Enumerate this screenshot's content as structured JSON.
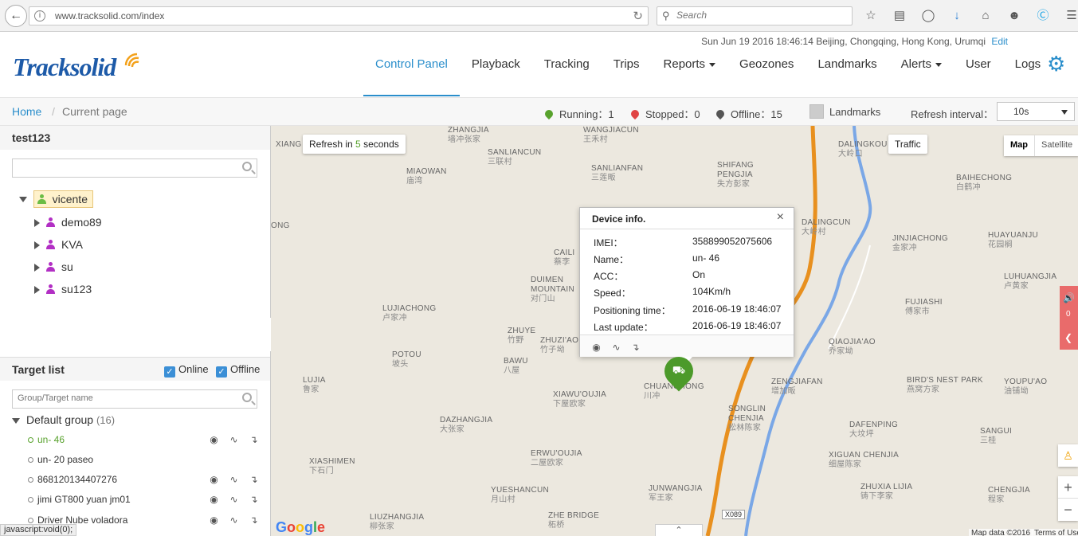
{
  "browser": {
    "url": "www.tracksolid.com/index",
    "search_placeholder": "Search"
  },
  "header": {
    "datetime": "Sun Jun 19 2016 18:46:14 Beijing, Chongqing, Hong Kong, Urumqi",
    "edit": "Edit",
    "logo_main": "Track",
    "logo_accent": "solid"
  },
  "nav": {
    "items": [
      {
        "label": "Control Panel"
      },
      {
        "label": "Playback"
      },
      {
        "label": "Tracking"
      },
      {
        "label": "Trips"
      },
      {
        "label": "Reports"
      },
      {
        "label": "Geozones"
      },
      {
        "label": "Landmarks"
      },
      {
        "label": "Alerts"
      },
      {
        "label": "User"
      },
      {
        "label": "Logs"
      }
    ]
  },
  "statusbar": {
    "home": "Home",
    "separator": "/",
    "current": "Current page",
    "running": "Running：1",
    "stopped": "Stopped：0",
    "offline": "Offline：15",
    "landmarks": "Landmarks",
    "refresh_label": "Refresh interval：",
    "refresh_value": "10s",
    "colors": {
      "running": "#58a22d",
      "stopped": "#e04343",
      "offline": "#555555"
    }
  },
  "accounts": {
    "title": "test123",
    "root": "vicente",
    "children": [
      "demo89",
      "KVA",
      "su",
      "su123"
    ],
    "colors": {
      "root_icon": "#6bbd45",
      "child_icon": "#b22fc4"
    }
  },
  "targets": {
    "title": "Target list",
    "online_label": "Online",
    "offline_label": "Offline",
    "search_placeholder": "Group/Target name",
    "group_name": "Default group",
    "group_count": "(16)",
    "items": [
      {
        "name": "un- 46"
      },
      {
        "name": "un- 20 paseo"
      },
      {
        "name": "868120134407276"
      },
      {
        "name": "jimi GT800 yuan jm01"
      },
      {
        "name": "Driver Nube voladora"
      }
    ]
  },
  "map": {
    "refresh_prefix": "Refresh in",
    "refresh_count": "5",
    "refresh_suffix": "seconds",
    "traffic": "Traffic",
    "map_btn": "Map",
    "satellite_btn": "Satellite",
    "road": "X089",
    "map_data": "Map data ©2016",
    "terms": "Terms of Use",
    "side_count": "0",
    "places": [
      {
        "en": "ZHANGJIA",
        "cn": "墙冲张家"
      },
      {
        "en": "WANGJIACUN",
        "cn": "王禾村"
      },
      {
        "en": "SANLIANCUN",
        "cn": "三联村"
      },
      {
        "en": "SANLIANFAN",
        "cn": "三莲畈"
      },
      {
        "en": "SHIFANG PENGJIA",
        "cn": "失方彭家"
      },
      {
        "en": "DALINGKOU",
        "cn": "大岭口"
      },
      {
        "en": "BAIHECHONG",
        "cn": "白鹤冲"
      },
      {
        "en": "MIAOWAN",
        "cn": "庙湾"
      },
      {
        "en": "DALINGCUN",
        "cn": "大岭村"
      },
      {
        "en": "JINJIACHONG",
        "cn": "金家冲"
      },
      {
        "en": "HUAYUANJU",
        "cn": "花园榈"
      },
      {
        "en": "CAILI",
        "cn": "蔡李"
      },
      {
        "en": "DUIMEN MOUNTAIN",
        "cn": "对门山"
      },
      {
        "en": "LUJIACHONG",
        "cn": "卢家冲"
      },
      {
        "en": "LUHUANGJIA",
        "cn": "卢黄家"
      },
      {
        "en": "FUJIASHI",
        "cn": "傅家市"
      },
      {
        "en": "ZHUYE",
        "cn": "竹野"
      },
      {
        "en": "ZHUZI'AO",
        "cn": "竹子坳"
      },
      {
        "en": "QIAOJIA'AO",
        "cn": "乔家坳"
      },
      {
        "en": "POTOU",
        "cn": "坡头"
      },
      {
        "en": "BAWU",
        "cn": "八屋"
      },
      {
        "en": "LUJIA",
        "cn": "鲁家"
      },
      {
        "en": "XIAWU'OUJIA",
        "cn": "下屋欧家"
      },
      {
        "en": "CHUANCHONG",
        "cn": "川冲"
      },
      {
        "en": "ZENGJIAFAN",
        "cn": "增加畈"
      },
      {
        "en": "BIRD'S NEST PARK",
        "cn": "燕窝方家"
      },
      {
        "en": "YOUPU'AO",
        "cn": "油铺坳"
      },
      {
        "en": "DAZHANGJIA",
        "cn": "大张家"
      },
      {
        "en": "SONGLIN CHENJIA",
        "cn": "松林陈家"
      },
      {
        "en": "DAFENPING",
        "cn": "大坟坪"
      },
      {
        "en": "SANGUI",
        "cn": "三桂"
      },
      {
        "en": "ERWU'OUJIA",
        "cn": "二屋欧家"
      },
      {
        "en": "XIGUAN CHENJIA",
        "cn": "细屋陈家"
      },
      {
        "en": "XIASHIMEN",
        "cn": "下石门"
      },
      {
        "en": "YUESHANCUN",
        "cn": "月山村"
      },
      {
        "en": "JUNWANGJIA",
        "cn": "军王家"
      },
      {
        "en": "ZHUXIA LIJIA",
        "cn": "铸下李家"
      },
      {
        "en": "CHENGJIA",
        "cn": "程家"
      },
      {
        "en": "LIUZHANGJIA",
        "cn": "柳张家"
      },
      {
        "en": "ZHE BRIDGE",
        "cn": "柘桥"
      },
      {
        "en": "XIANG",
        "cn": ""
      },
      {
        "en": "ONG",
        "cn": ""
      }
    ],
    "colors": {
      "marker": "#4c9a2a",
      "river": "#7aa7e6",
      "highway": "#e8901f"
    }
  },
  "popup": {
    "title": "Device info.",
    "close": "×",
    "rows": [
      {
        "label": "IMEI：",
        "value": "358899052075606"
      },
      {
        "label": "Name：",
        "value": "un- 46"
      },
      {
        "label": "ACC：",
        "value": "On"
      },
      {
        "label": "Speed：",
        "value": "104Km/h"
      },
      {
        "label": "Positioning time：",
        "value": "2016-06-19 18:46:07"
      },
      {
        "label": "Last update：",
        "value": "2016-06-19 18:46:07"
      }
    ]
  },
  "statusline": "javascript:void(0);"
}
